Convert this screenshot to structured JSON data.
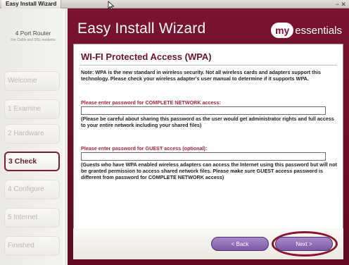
{
  "window": {
    "title": "Easy Install Wizard",
    "controls": "− ✕"
  },
  "sidebar": {
    "product_name": "4 Port Router",
    "product_sub": "For Cable and DSL modems",
    "steps": [
      {
        "label": "Welcome",
        "active": false
      },
      {
        "label": "1 Examine",
        "active": false
      },
      {
        "label": "2 Hardware",
        "active": false
      },
      {
        "label": "3 Check",
        "active": true
      },
      {
        "label": "4 Configure",
        "active": false
      },
      {
        "label": "5 Internet",
        "active": false
      },
      {
        "label": "Finished",
        "active": false
      }
    ]
  },
  "header": {
    "title": "Easy Install Wizard",
    "logo_pill": "my",
    "logo_word": "essentials"
  },
  "panel": {
    "title": "WI-FI Protected Access (WPA)",
    "note": "Note: WPA is the new standard in wireless security.  Not all wireless cards and adapters support this technology.  Please check your wireless adapter's user manual to determine if it supports WPA.",
    "complete_label": "Please enter password for COMPLETE NETWORK access:",
    "complete_value": "",
    "complete_hint": "(Please be careful about sharing this password as the user would get administrator rights and full access to your entire network including your shared files)",
    "guest_label": "Please enter password for GUEST access (optional):",
    "guest_value": "",
    "guest_hint": "(Guests who have WPA enabled wireless adapters can access the Internet using this password but will not be granted permission to access shared network files. Please make sure GUEST access password is different from password for COMPLETE NETWORK access)"
  },
  "buttons": {
    "back": "< Back",
    "next": "Next >"
  },
  "colors": {
    "header_maroon": "#7a1430",
    "active_step": "#6b1530",
    "field_label": "#a4263f",
    "button_purple": "#8e6cb6",
    "highlight_ring": "#8a1330"
  }
}
